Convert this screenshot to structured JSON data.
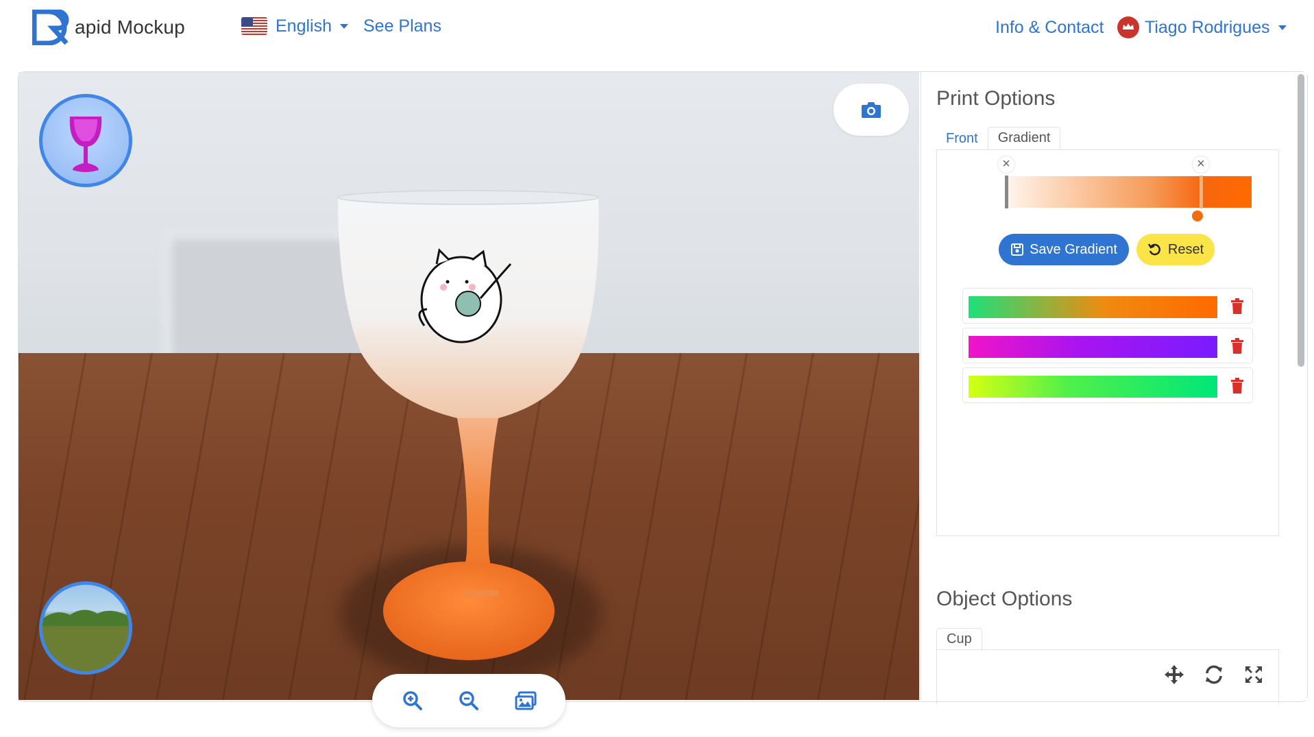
{
  "header": {
    "brand_text": "apid Mockup",
    "language_label": "English",
    "plans_link": "See Plans",
    "info_link": "Info & Contact",
    "user_name": "Tiago Rodrigues"
  },
  "viewer": {
    "object_thumb_icon": "goblet-icon",
    "environment_thumb_icon": "landscape-icon",
    "camera_icon": "camera-icon",
    "zoom_controls": [
      "zoom-in-icon",
      "zoom-out-icon",
      "images-icon"
    ]
  },
  "print_options": {
    "heading": "Print Options",
    "tabs": [
      {
        "label": "Front",
        "active": false
      },
      {
        "label": "Gradient",
        "active": true
      }
    ],
    "gradient_editor": {
      "colors": [
        "#fff6ee",
        "#ff6a00"
      ]
    },
    "save_label": "Save Gradient",
    "reset_label": "Reset",
    "presets": [
      {
        "from": "#1ee07a",
        "to": "#ff6a00"
      },
      {
        "from": "#f014c8",
        "to": "#7a1cff"
      },
      {
        "from": "#d6ff14",
        "to": "#00e67a"
      }
    ]
  },
  "object_options": {
    "heading": "Object Options",
    "tab_label": "Cup",
    "tools": [
      "move-icon",
      "rotate-icon",
      "scale-icon"
    ]
  },
  "colors": {
    "accent": "#2f74d0",
    "reset": "#fbe448",
    "danger": "#d9302c",
    "goblet_base": "#f26b1d"
  }
}
